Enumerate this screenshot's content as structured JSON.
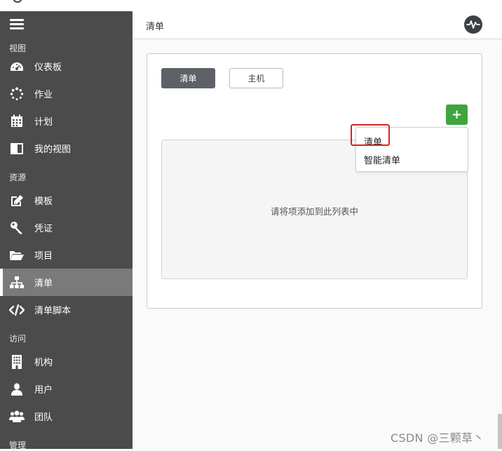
{
  "header": {
    "title": "清单"
  },
  "sidebar": {
    "sections": {
      "views": "视图",
      "resources": "资源",
      "access": "访问",
      "admin": "管理"
    },
    "items": [
      {
        "label": "仪表板",
        "icon": "dashboard-icon"
      },
      {
        "label": "作业",
        "icon": "spinner-icon"
      },
      {
        "label": "计划",
        "icon": "calendar-icon"
      },
      {
        "label": "我的视图",
        "icon": "columns-icon"
      },
      {
        "label": "模板",
        "icon": "edit-icon"
      },
      {
        "label": "凭证",
        "icon": "key-icon"
      },
      {
        "label": "项目",
        "icon": "folder-open-icon"
      },
      {
        "label": "清单",
        "icon": "sitemap-icon",
        "active": true
      },
      {
        "label": "清单脚本",
        "icon": "code-icon"
      },
      {
        "label": "机构",
        "icon": "building-icon"
      },
      {
        "label": "用户",
        "icon": "user-icon"
      },
      {
        "label": "团队",
        "icon": "users-icon"
      }
    ]
  },
  "main": {
    "tabs": [
      {
        "label": "清单",
        "active": true
      },
      {
        "label": "主机",
        "active": false
      }
    ],
    "add_button": "+",
    "empty_message": "请将项添加到此列表中",
    "dropdown": {
      "items": [
        "清单",
        "智能清单"
      ]
    }
  },
  "watermark": "CSDN @三颗草丶",
  "colors": {
    "sidebar_bg": "#4b4b4b",
    "active_item_bg": "#7a7a7a",
    "add_button": "#3fa53d",
    "highlight": "#e02020"
  }
}
